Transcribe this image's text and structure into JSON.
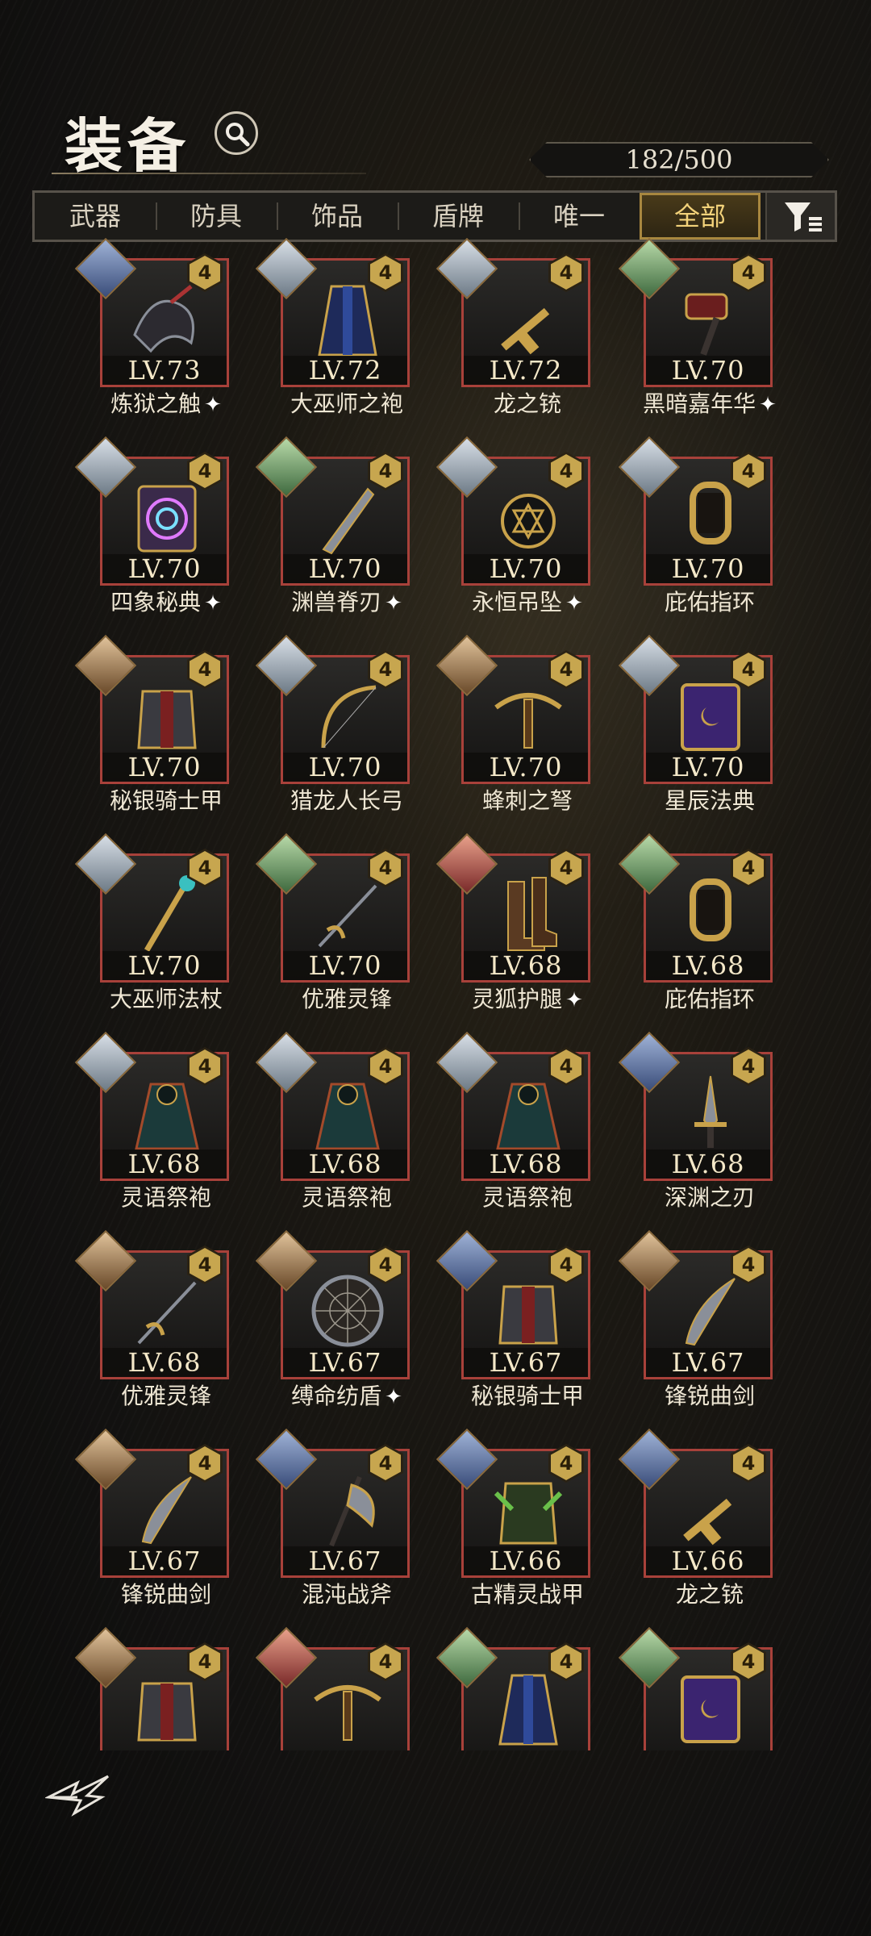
{
  "header": {
    "title": "装备",
    "counter": "182/500"
  },
  "tabs": [
    {
      "label": "武器",
      "active": false
    },
    {
      "label": "防具",
      "active": false
    },
    {
      "label": "饰品",
      "active": false
    },
    {
      "label": "盾牌",
      "active": false
    },
    {
      "label": "唯一",
      "active": false
    },
    {
      "label": "全部",
      "active": true
    }
  ],
  "items": [
    {
      "level": "LV.73",
      "name": "炼狱之触",
      "star": true,
      "grade": "4",
      "art": "dark-claw",
      "avatar": "blue"
    },
    {
      "level": "LV.72",
      "name": "大巫师之袍",
      "star": false,
      "grade": "4",
      "art": "robe-blue",
      "avatar": "silver"
    },
    {
      "level": "LV.72",
      "name": "龙之铳",
      "star": false,
      "grade": "4",
      "art": "gun",
      "avatar": "silver"
    },
    {
      "level": "LV.70",
      "name": "黑暗嘉年华",
      "star": true,
      "grade": "4",
      "art": "hammer",
      "avatar": "green"
    },
    {
      "level": "LV.70",
      "name": "四象秘典",
      "star": true,
      "grade": "4",
      "art": "book-rainbow",
      "avatar": "silver"
    },
    {
      "level": "LV.70",
      "name": "渊兽脊刃",
      "star": true,
      "grade": "4",
      "art": "blade",
      "avatar": "green"
    },
    {
      "level": "LV.70",
      "name": "永恒吊坠",
      "star": true,
      "grade": "4",
      "art": "pendant",
      "avatar": "silver"
    },
    {
      "level": "LV.70",
      "name": "庇佑指环",
      "star": false,
      "grade": "4",
      "art": "ring",
      "avatar": "silver"
    },
    {
      "level": "LV.70",
      "name": "秘银骑士甲",
      "star": false,
      "grade": "4",
      "art": "armor",
      "avatar": "brown"
    },
    {
      "level": "LV.70",
      "name": "猎龙人长弓",
      "star": false,
      "grade": "4",
      "art": "bow",
      "avatar": "silver"
    },
    {
      "level": "LV.70",
      "name": "蜂刺之弩",
      "star": false,
      "grade": "4",
      "art": "crossbow",
      "avatar": "brown"
    },
    {
      "level": "LV.70",
      "name": "星辰法典",
      "star": false,
      "grade": "4",
      "art": "book-purple",
      "avatar": "silver"
    },
    {
      "level": "LV.70",
      "name": "大巫师法杖",
      "star": false,
      "grade": "4",
      "art": "staff",
      "avatar": "silver"
    },
    {
      "level": "LV.70",
      "name": "优雅灵锋",
      "star": false,
      "grade": "4",
      "art": "rapier",
      "avatar": "green"
    },
    {
      "level": "LV.68",
      "name": "灵狐护腿",
      "star": true,
      "grade": "4",
      "art": "boots",
      "avatar": "red"
    },
    {
      "level": "LV.68",
      "name": "庇佑指环",
      "star": false,
      "grade": "4",
      "art": "ring",
      "avatar": "green"
    },
    {
      "level": "LV.68",
      "name": "灵语祭袍",
      "star": false,
      "grade": "4",
      "art": "robe-teal",
      "avatar": "silver"
    },
    {
      "level": "LV.68",
      "name": "灵语祭袍",
      "star": false,
      "grade": "4",
      "art": "robe-teal",
      "avatar": "silver"
    },
    {
      "level": "LV.68",
      "name": "灵语祭袍",
      "star": false,
      "grade": "4",
      "art": "robe-teal",
      "avatar": "silver"
    },
    {
      "level": "LV.68",
      "name": "深渊之刃",
      "star": false,
      "grade": "4",
      "art": "dagger",
      "avatar": "blue"
    },
    {
      "level": "LV.68",
      "name": "优雅灵锋",
      "star": false,
      "grade": "4",
      "art": "rapier",
      "avatar": "brown"
    },
    {
      "level": "LV.67",
      "name": "缚命纺盾",
      "star": true,
      "grade": "4",
      "art": "shield",
      "avatar": "brown"
    },
    {
      "level": "LV.67",
      "name": "秘银骑士甲",
      "star": false,
      "grade": "4",
      "art": "armor",
      "avatar": "blue"
    },
    {
      "level": "LV.67",
      "name": "锋锐曲剑",
      "star": false,
      "grade": "4",
      "art": "scimitar",
      "avatar": "brown"
    },
    {
      "level": "LV.67",
      "name": "锋锐曲剑",
      "star": false,
      "grade": "4",
      "art": "scimitar",
      "avatar": "brown"
    },
    {
      "level": "LV.67",
      "name": "混沌战斧",
      "star": false,
      "grade": "4",
      "art": "axe",
      "avatar": "blue"
    },
    {
      "level": "LV.66",
      "name": "古精灵战甲",
      "star": false,
      "grade": "4",
      "art": "elf-armor",
      "avatar": "blue"
    },
    {
      "level": "LV.66",
      "name": "龙之铳",
      "star": false,
      "grade": "4",
      "art": "gun",
      "avatar": "blue"
    },
    {
      "level": "",
      "name": "",
      "star": false,
      "grade": "4",
      "art": "armor",
      "avatar": "brown"
    },
    {
      "level": "",
      "name": "",
      "star": false,
      "grade": "4",
      "art": "crossbow",
      "avatar": "red"
    },
    {
      "level": "",
      "name": "",
      "star": false,
      "grade": "4",
      "art": "robe-blue",
      "avatar": "green"
    },
    {
      "level": "",
      "name": "",
      "star": false,
      "grade": "4",
      "art": "book-purple",
      "avatar": "green"
    }
  ],
  "colors": {
    "accent_gold": "#c7a64f",
    "card_border_red": "#a8413a",
    "active_tab": "#f3d27a"
  }
}
